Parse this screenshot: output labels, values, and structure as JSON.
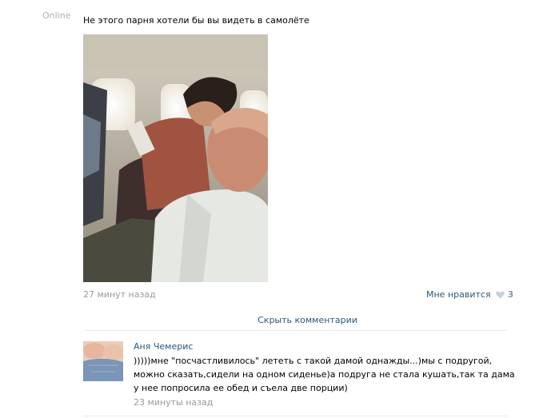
{
  "status": {
    "online": "Online"
  },
  "post": {
    "text": "Не этого парня хотели бы вы видеть в самолёте",
    "time": "27 минут назад",
    "like_label": "Мне нравится",
    "like_count": "3",
    "photo_icon": "airplane-passengers-photo"
  },
  "comments_toggle": {
    "label": "Скрыть комментарии"
  },
  "comment": {
    "author": "Аня Чемерис",
    "text": ")))))мне \"посчастливилось\" лететь с такой дамой однажды...)мы с подругой, можно сказать,сидели на одном сиденье)а подруга не стала кушать,так та дама у нее попросила ее обед и съела две порции)",
    "time": "23 минуты назад"
  },
  "colors": {
    "link": "#2b587a",
    "muted": "#9a9a9a",
    "divider": "#e7eaed"
  }
}
